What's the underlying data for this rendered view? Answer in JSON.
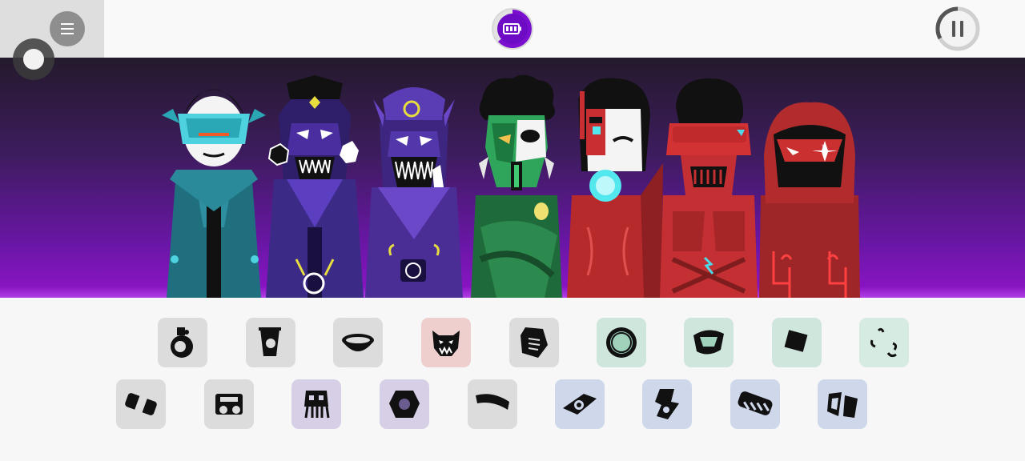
{
  "app": {
    "topbar": {
      "menu_icon": "hamburger-menu-icon",
      "mode_icon": "battery-icon",
      "pause_icon": "pause-icon",
      "colors": {
        "topbar": "#f9f9f9",
        "menu_panel": "#dedede",
        "mode_accent": "#7a0fd0",
        "pause_ring": "#555555"
      }
    },
    "stage": {
      "background_top": "#241a2c",
      "background_bottom": "#8f14c9",
      "characters": [
        {
          "name": "teal-visor-character",
          "color": "#1f6f7e",
          "accent": "#4fd2df"
        },
        {
          "name": "purple-skull-character",
          "color": "#3c2b86",
          "accent": "#ffffff"
        },
        {
          "name": "violet-grin-character",
          "color": "#4a2e96",
          "accent": "#e8dd3f"
        },
        {
          "name": "green-mask-character",
          "color": "#1f6a3a",
          "accent": "#40c970"
        },
        {
          "name": "red-cyborg-character",
          "color": "#b62a2c",
          "accent": "#53e8ee"
        },
        {
          "name": "red-helmet-character",
          "color": "#c32f32",
          "accent": "#4fd9e8"
        },
        {
          "name": "red-hood-character",
          "color": "#9e2628",
          "accent": "#ff4040"
        }
      ]
    },
    "palette": {
      "row1": [
        {
          "icon": "gray-bell-icon",
          "bg": "#dcdcdc"
        },
        {
          "icon": "gray-cup-icon",
          "bg": "#dcdcdc"
        },
        {
          "icon": "gray-bowl-icon",
          "bg": "#dcdcdc"
        },
        {
          "icon": "red-monster-icon",
          "bg": "#efcece"
        },
        {
          "icon": "gray-note-icon",
          "bg": "#dcdcdc"
        },
        {
          "icon": "green-gear-ring-icon",
          "bg": "#cfe6dc"
        },
        {
          "icon": "green-leaf-icon",
          "bg": "#cfe6dc"
        },
        {
          "icon": "green-square-icon",
          "bg": "#cfe6dc"
        },
        {
          "icon": "green-dots-icon",
          "bg": "#d6ebe2"
        }
      ],
      "row2": [
        {
          "icon": "gray-capsule-icon",
          "bg": "#dcdcdc"
        },
        {
          "icon": "gray-machine-icon",
          "bg": "#dcdcdc"
        },
        {
          "icon": "purple-squid-icon",
          "bg": "#d6cfe6"
        },
        {
          "icon": "purple-hex-icon",
          "bg": "#d6cfe6"
        },
        {
          "icon": "gray-band-icon",
          "bg": "#dcdcdc"
        },
        {
          "icon": "blue-eye-icon",
          "bg": "#cfd8eb"
        },
        {
          "icon": "blue-bolt-icon",
          "bg": "#cfd8eb"
        },
        {
          "icon": "blue-chain-icon",
          "bg": "#cfd8eb"
        },
        {
          "icon": "blue-shards-icon",
          "bg": "#cfd8eb"
        }
      ]
    }
  }
}
